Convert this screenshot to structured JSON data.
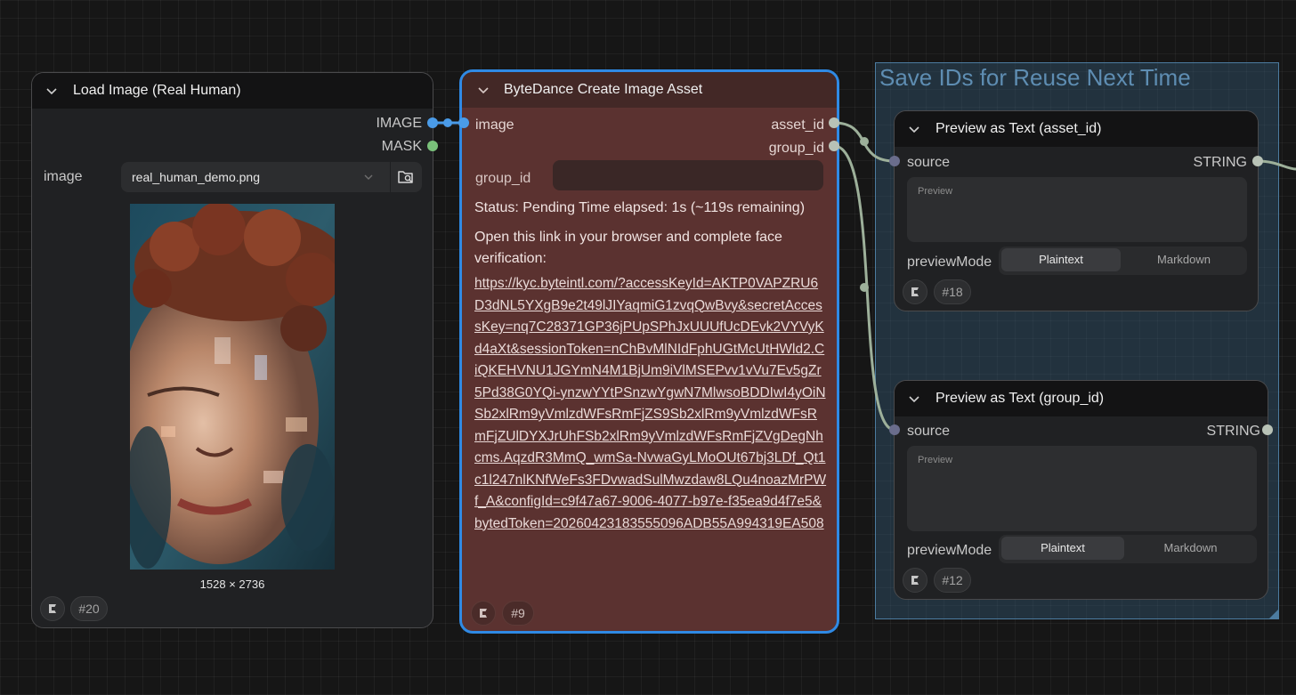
{
  "colors": {
    "canvas_bg": "#161616",
    "node_bg": "#202123",
    "node_header": "#131314",
    "bytedance_bg": "#5b3230",
    "selected_border": "#2f8ae5",
    "image_link": "#4a9be8",
    "mask_link": "#7ac17a",
    "string_link": "#9db09a",
    "group_bg": "#386080",
    "group_title": "#5e8db2"
  },
  "group": {
    "title": "Save IDs for Reuse Next Time"
  },
  "load_image_node": {
    "title": "Load Image (Real Human)",
    "outputs": [
      "IMAGE",
      "MASK"
    ],
    "widget_label": "image",
    "widget_value": "real_human_demo.png",
    "dimensions": "1528 × 2736",
    "node_id": "#20",
    "icons": [
      "chevron-down-icon",
      "folder-search-icon",
      "comfy-logo-icon"
    ]
  },
  "bytedance_node": {
    "title": "ByteDance Create Image Asset",
    "input": "image",
    "outputs": [
      "asset_id",
      "group_id"
    ],
    "widget_label": "group_id",
    "widget_value": "",
    "status": "Status: Pending Time elapsed: 1s (~119s remaining)",
    "instruction_line1": "Open this link in your browser and complete face",
    "instruction_line2": "verification:",
    "link": "https://kyc.byteintl.com/?accessKeyId=AKTP0VAPZRU6D3dNL5YXgB9e2t49lJIYaqmiG1zvqQwBvy&secretAccessKey=nq7C28371GP36jPUpSPhJxUUUfUcDEvk2VYVyKd4aXt&sessionToken=nChBvMlNIdFphUGtMcUtHWld2.CiQKEHVNU1JGYmN4M1BjUm9iVlMSEPvv1vVu7Ev5gZr5Pd38G0YQi-ynzwYYtPSnzwYgwN7MlwsoBDDIwI4yOiNSb2xlRm9yVmlzdWFsRmFjZS9Sb2xlRm9yVmlzdWFsRmFjZUlDYXJrUhFSb2xlRm9yVmlzdWFsRmFjZVgDegNhcms.AqzdR3MmQ_wmSa-NvwaGyLMoOUt67bj3LDf_Qt1c1l247nlKNfWeFs3FDvwadSulMwzdaw8LQu4noazMrPWf_A&configId=c9f47a67-9006-4077-b97e-f35ea9d4f7e5&bytedToken=20260423183555096ADB55A994319EA508",
    "node_id": "#9"
  },
  "preview_asset_node": {
    "title": "Preview as Text (asset_id)",
    "input": "source",
    "output": "STRING",
    "preview_placeholder": "Preview",
    "mode_label": "previewMode",
    "mode_options": [
      "Plaintext",
      "Markdown"
    ],
    "selected_mode": "Plaintext",
    "node_id": "#18"
  },
  "preview_group_node": {
    "title": "Preview as Text (group_id)",
    "input": "source",
    "output": "STRING",
    "preview_placeholder": "Preview",
    "mode_label": "previewMode",
    "mode_options": [
      "Plaintext",
      "Markdown"
    ],
    "selected_mode": "Plaintext",
    "node_id": "#12"
  }
}
